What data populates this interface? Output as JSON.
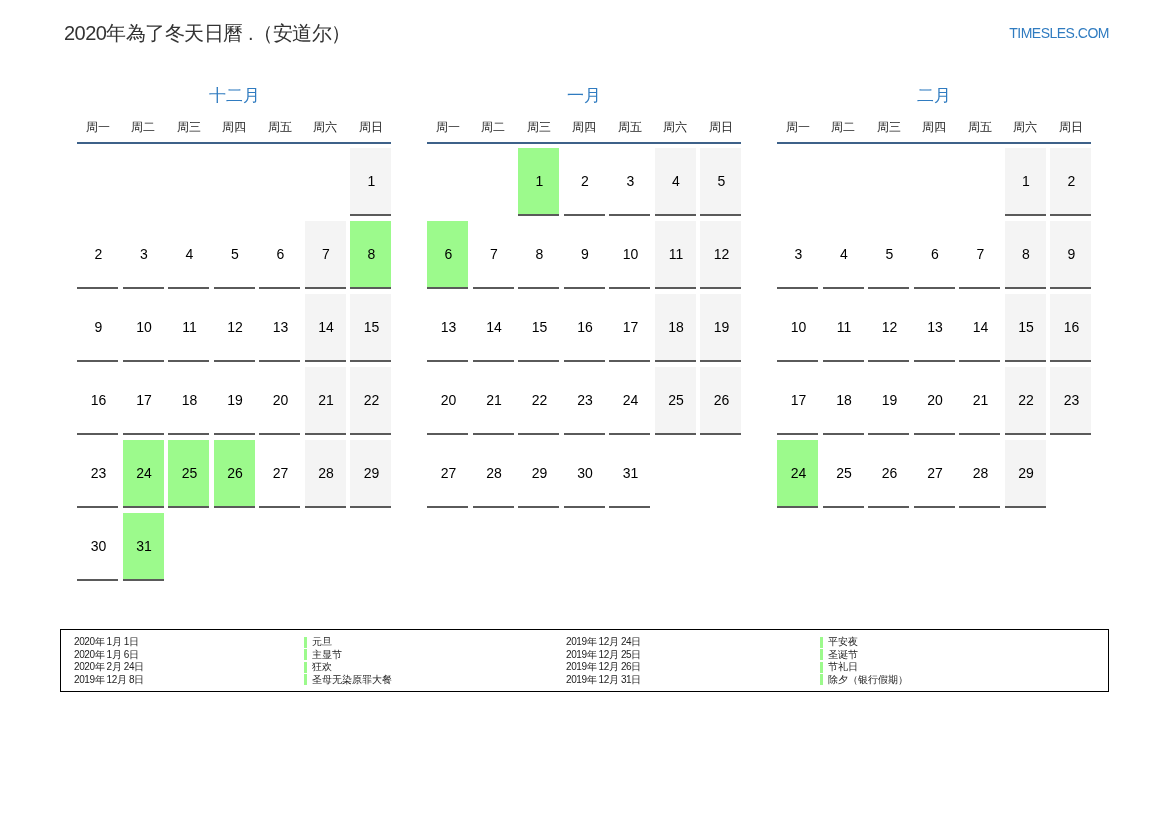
{
  "header": {
    "title": "2020年為了冬天日曆 .（安道尔）",
    "logo": "TIMESLES.COM"
  },
  "months": [
    {
      "name": "十二月",
      "weekdays": [
        "周一",
        "周二",
        "周三",
        "周四",
        "周五",
        "周六",
        "周日"
      ],
      "weeks": [
        [
          {
            "kind": "blank"
          },
          {
            "kind": "blank"
          },
          {
            "kind": "blank"
          },
          {
            "kind": "blank"
          },
          {
            "kind": "blank"
          },
          {
            "kind": "blank"
          },
          {
            "day": "1",
            "kind": "weekend"
          }
        ],
        [
          {
            "day": "2",
            "kind": "weekday"
          },
          {
            "day": "3",
            "kind": "weekday"
          },
          {
            "day": "4",
            "kind": "weekday"
          },
          {
            "day": "5",
            "kind": "weekday"
          },
          {
            "day": "6",
            "kind": "weekday"
          },
          {
            "day": "7",
            "kind": "weekend"
          },
          {
            "day": "8",
            "kind": "holiday"
          }
        ],
        [
          {
            "day": "9",
            "kind": "weekday"
          },
          {
            "day": "10",
            "kind": "weekday"
          },
          {
            "day": "11",
            "kind": "weekday"
          },
          {
            "day": "12",
            "kind": "weekday"
          },
          {
            "day": "13",
            "kind": "weekday"
          },
          {
            "day": "14",
            "kind": "weekend"
          },
          {
            "day": "15",
            "kind": "weekend"
          }
        ],
        [
          {
            "day": "16",
            "kind": "weekday"
          },
          {
            "day": "17",
            "kind": "weekday"
          },
          {
            "day": "18",
            "kind": "weekday"
          },
          {
            "day": "19",
            "kind": "weekday"
          },
          {
            "day": "20",
            "kind": "weekday"
          },
          {
            "day": "21",
            "kind": "weekend"
          },
          {
            "day": "22",
            "kind": "weekend"
          }
        ],
        [
          {
            "day": "23",
            "kind": "weekday"
          },
          {
            "day": "24",
            "kind": "holiday"
          },
          {
            "day": "25",
            "kind": "holiday"
          },
          {
            "day": "26",
            "kind": "holiday"
          },
          {
            "day": "27",
            "kind": "weekday"
          },
          {
            "day": "28",
            "kind": "weekend"
          },
          {
            "day": "29",
            "kind": "weekend"
          }
        ],
        [
          {
            "day": "30",
            "kind": "weekday"
          },
          {
            "day": "31",
            "kind": "holiday"
          }
        ]
      ]
    },
    {
      "name": "一月",
      "weekdays": [
        "周一",
        "周二",
        "周三",
        "周四",
        "周五",
        "周六",
        "周日"
      ],
      "weeks": [
        [
          {
            "kind": "blank"
          },
          {
            "kind": "blank"
          },
          {
            "day": "1",
            "kind": "holiday"
          },
          {
            "day": "2",
            "kind": "weekday"
          },
          {
            "day": "3",
            "kind": "weekday"
          },
          {
            "day": "4",
            "kind": "weekend"
          },
          {
            "day": "5",
            "kind": "weekend"
          }
        ],
        [
          {
            "day": "6",
            "kind": "holiday"
          },
          {
            "day": "7",
            "kind": "weekday"
          },
          {
            "day": "8",
            "kind": "weekday"
          },
          {
            "day": "9",
            "kind": "weekday"
          },
          {
            "day": "10",
            "kind": "weekday"
          },
          {
            "day": "11",
            "kind": "weekend"
          },
          {
            "day": "12",
            "kind": "weekend"
          }
        ],
        [
          {
            "day": "13",
            "kind": "weekday"
          },
          {
            "day": "14",
            "kind": "weekday"
          },
          {
            "day": "15",
            "kind": "weekday"
          },
          {
            "day": "16",
            "kind": "weekday"
          },
          {
            "day": "17",
            "kind": "weekday"
          },
          {
            "day": "18",
            "kind": "weekend"
          },
          {
            "day": "19",
            "kind": "weekend"
          }
        ],
        [
          {
            "day": "20",
            "kind": "weekday"
          },
          {
            "day": "21",
            "kind": "weekday"
          },
          {
            "day": "22",
            "kind": "weekday"
          },
          {
            "day": "23",
            "kind": "weekday"
          },
          {
            "day": "24",
            "kind": "weekday"
          },
          {
            "day": "25",
            "kind": "weekend"
          },
          {
            "day": "26",
            "kind": "weekend"
          }
        ],
        [
          {
            "day": "27",
            "kind": "weekday"
          },
          {
            "day": "28",
            "kind": "weekday"
          },
          {
            "day": "29",
            "kind": "weekday"
          },
          {
            "day": "30",
            "kind": "weekday"
          },
          {
            "day": "31",
            "kind": "weekday"
          }
        ]
      ]
    },
    {
      "name": "二月",
      "weekdays": [
        "周一",
        "周二",
        "周三",
        "周四",
        "周五",
        "周六",
        "周日"
      ],
      "weeks": [
        [
          {
            "kind": "blank"
          },
          {
            "kind": "blank"
          },
          {
            "kind": "blank"
          },
          {
            "kind": "blank"
          },
          {
            "kind": "blank"
          },
          {
            "day": "1",
            "kind": "weekend"
          },
          {
            "day": "2",
            "kind": "weekend"
          }
        ],
        [
          {
            "day": "3",
            "kind": "weekday"
          },
          {
            "day": "4",
            "kind": "weekday"
          },
          {
            "day": "5",
            "kind": "weekday"
          },
          {
            "day": "6",
            "kind": "weekday"
          },
          {
            "day": "7",
            "kind": "weekday"
          },
          {
            "day": "8",
            "kind": "weekend"
          },
          {
            "day": "9",
            "kind": "weekend"
          }
        ],
        [
          {
            "day": "10",
            "kind": "weekday"
          },
          {
            "day": "11",
            "kind": "weekday"
          },
          {
            "day": "12",
            "kind": "weekday"
          },
          {
            "day": "13",
            "kind": "weekday"
          },
          {
            "day": "14",
            "kind": "weekday"
          },
          {
            "day": "15",
            "kind": "weekend"
          },
          {
            "day": "16",
            "kind": "weekend"
          }
        ],
        [
          {
            "day": "17",
            "kind": "weekday"
          },
          {
            "day": "18",
            "kind": "weekday"
          },
          {
            "day": "19",
            "kind": "weekday"
          },
          {
            "day": "20",
            "kind": "weekday"
          },
          {
            "day": "21",
            "kind": "weekday"
          },
          {
            "day": "22",
            "kind": "weekend"
          },
          {
            "day": "23",
            "kind": "weekend"
          }
        ],
        [
          {
            "day": "24",
            "kind": "holiday"
          },
          {
            "day": "25",
            "kind": "weekday"
          },
          {
            "day": "26",
            "kind": "weekday"
          },
          {
            "day": "27",
            "kind": "weekday"
          },
          {
            "day": "28",
            "kind": "weekday"
          },
          {
            "day": "29",
            "kind": "weekend"
          }
        ]
      ]
    }
  ],
  "legend": [
    {
      "date": "2020年 1月 1日",
      "name": "元旦"
    },
    {
      "date": "2020年 1月 6日",
      "name": "主显节"
    },
    {
      "date": "2020年 2月 24日",
      "name": "狂欢"
    },
    {
      "date": "2019年 12月 8日",
      "name": "圣母无染原罪大餐"
    },
    {
      "date": "2019年 12月 24日",
      "name": "平安夜"
    },
    {
      "date": "2019年 12月 25日",
      "name": "圣诞节"
    },
    {
      "date": "2019年 12月 26日",
      "name": "节礼日"
    },
    {
      "date": "2019年 12月 31日",
      "name": "除夕（银行假期）"
    }
  ]
}
